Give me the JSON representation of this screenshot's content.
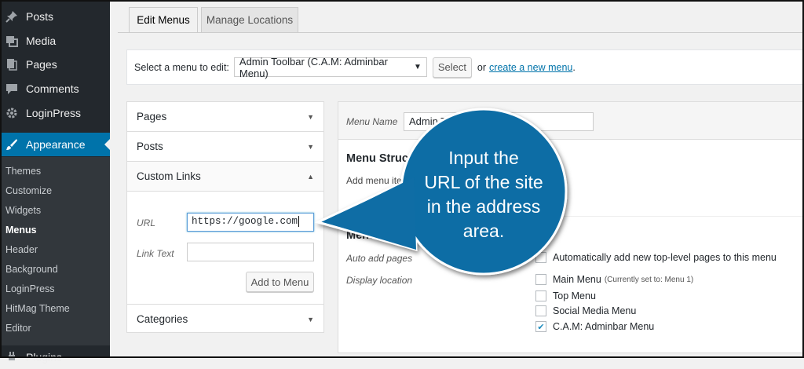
{
  "sidebar": {
    "top_items": [
      {
        "label": "Posts",
        "icon": "pin-icon"
      },
      {
        "label": "Media",
        "icon": "media-icon"
      },
      {
        "label": "Pages",
        "icon": "pages-icon"
      },
      {
        "label": "Comments",
        "icon": "comments-icon"
      },
      {
        "label": "LoginPress",
        "icon": "gear-icon"
      }
    ],
    "active_item": {
      "label": "Appearance",
      "icon": "brush-icon"
    },
    "submenu": [
      "Themes",
      "Customize",
      "Widgets",
      "Menus",
      "Header",
      "Background",
      "LoginPress",
      "HitMag Theme",
      "Editor"
    ],
    "current_submenu": "Menus",
    "bottom_item": {
      "label": "Plugins",
      "icon": "plugin-icon"
    }
  },
  "tabs": {
    "edit_menus": "Edit Menus",
    "manage_locations": "Manage Locations"
  },
  "select_bar": {
    "label": "Select a menu to edit:",
    "selected": "Admin Toolbar (C.A.M: Adminbar Menu)",
    "select_button": "Select",
    "or_text": "or",
    "create_link": "create a new menu",
    "period": "."
  },
  "accordion": {
    "pages": "Pages",
    "posts": "Posts",
    "custom_links": "Custom Links",
    "url_label": "URL",
    "url_value": "https://google.com",
    "link_text_label": "Link Text",
    "link_text_value": "",
    "add_button": "Add to Menu",
    "categories": "Categories"
  },
  "panel": {
    "menu_name_label": "Menu Name",
    "menu_name_value": "Admin Toolbar",
    "structure_title": "Menu Structure",
    "structure_text": "Add menu items from the column on the left.",
    "settings_title": "Menu Settings",
    "auto_add_label": "Auto add pages",
    "auto_add_text": "Automatically add new top-level pages to this menu",
    "display_location_label": "Display location",
    "locations": [
      {
        "label": "Main Menu",
        "note": "(Currently set to: Menu 1)",
        "checked": false
      },
      {
        "label": "Top Menu",
        "note": "",
        "checked": false
      },
      {
        "label": "Social Media Menu",
        "note": "",
        "checked": false
      },
      {
        "label": "C.A.M: Adminbar Menu",
        "note": "",
        "checked": true
      }
    ]
  },
  "callout": {
    "lines": [
      "Input the",
      "URL of the site",
      "in the address",
      "area."
    ],
    "color": "#0f6da5"
  },
  "colors": {
    "sidebar_bg": "#23282d",
    "submenu_bg": "#32373c",
    "accent": "#0073aa"
  }
}
